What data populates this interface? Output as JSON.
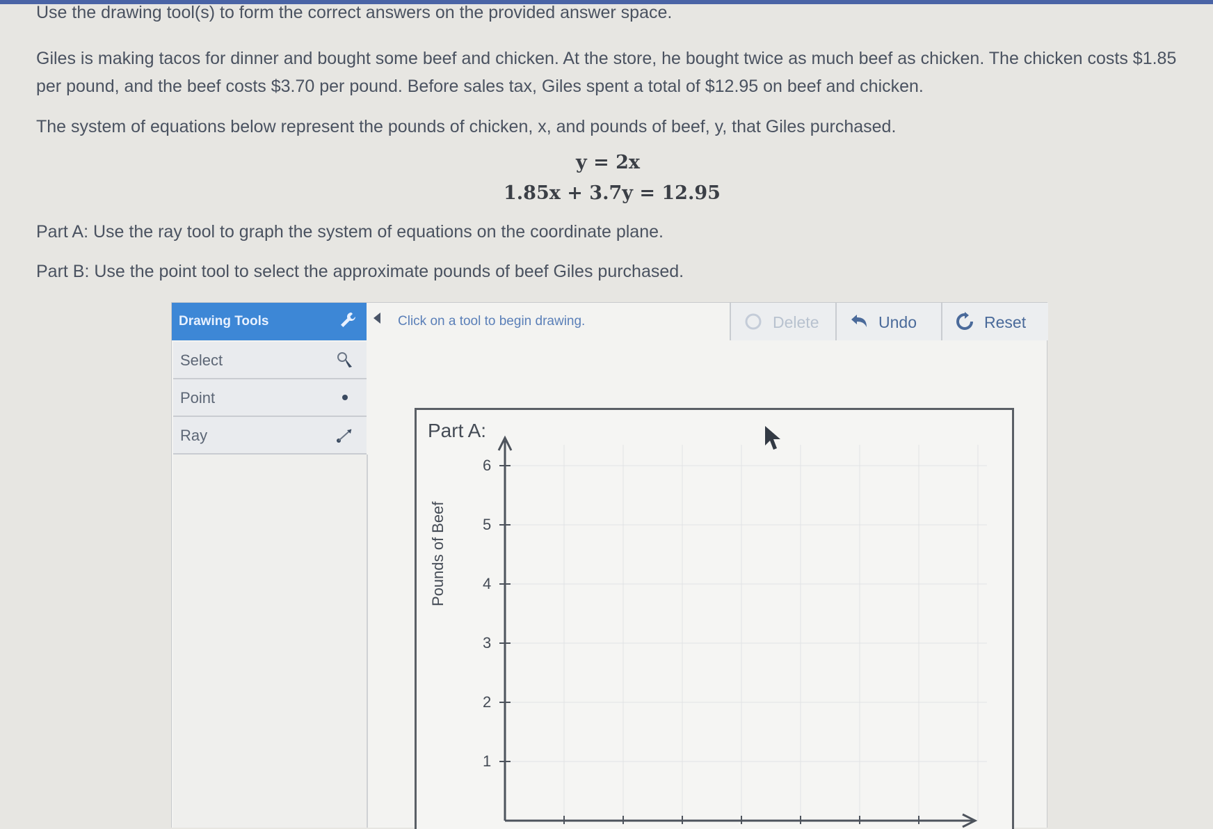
{
  "instructions": "Use the drawing tool(s) to form the correct answers on the provided answer space.",
  "problem": {
    "paragraph1": "Giles is making tacos for dinner and bought some beef and chicken. At the store, he bought twice as much beef as chicken. The chicken costs $1.85 per pound, and the beef costs $3.70 per pound. Before sales tax, Giles spent a total of $12.95 on beef and chicken.",
    "paragraph2": "The system of equations below represent the pounds of chicken, x, and pounds of beef, y, that Giles purchased.",
    "equation1": "y = 2x",
    "equation2": "1.85x + 3.7y = 12.95",
    "partA": "Part A: Use the ray tool to graph the system of equations on the coordinate plane.",
    "partB": "Part B: Use the point tool to select the approximate pounds of beef Giles purchased."
  },
  "widget": {
    "header_title": "Drawing Tools",
    "header_icon": "wrench-icon",
    "tools": [
      {
        "label": "Select",
        "icon": "select-icon"
      },
      {
        "label": "Point",
        "icon": "point-icon"
      },
      {
        "label": "Ray",
        "icon": "ray-icon"
      }
    ],
    "status_text": "Click on a tool to begin drawing.",
    "buttons": {
      "delete": "Delete",
      "undo": "Undo",
      "reset": "Reset"
    }
  },
  "graph": {
    "title": "Part A:",
    "ylabel": "Pounds of Beef",
    "y_ticks": [
      "1",
      "2",
      "3",
      "4",
      "5",
      "6"
    ]
  },
  "chart_data": {
    "type": "scatter",
    "title": "Part A:",
    "xlabel": "",
    "ylabel": "Pounds of Beef",
    "y_tick_labels": [
      "1",
      "2",
      "3",
      "4",
      "5",
      "6"
    ],
    "series": [],
    "grid": true
  }
}
